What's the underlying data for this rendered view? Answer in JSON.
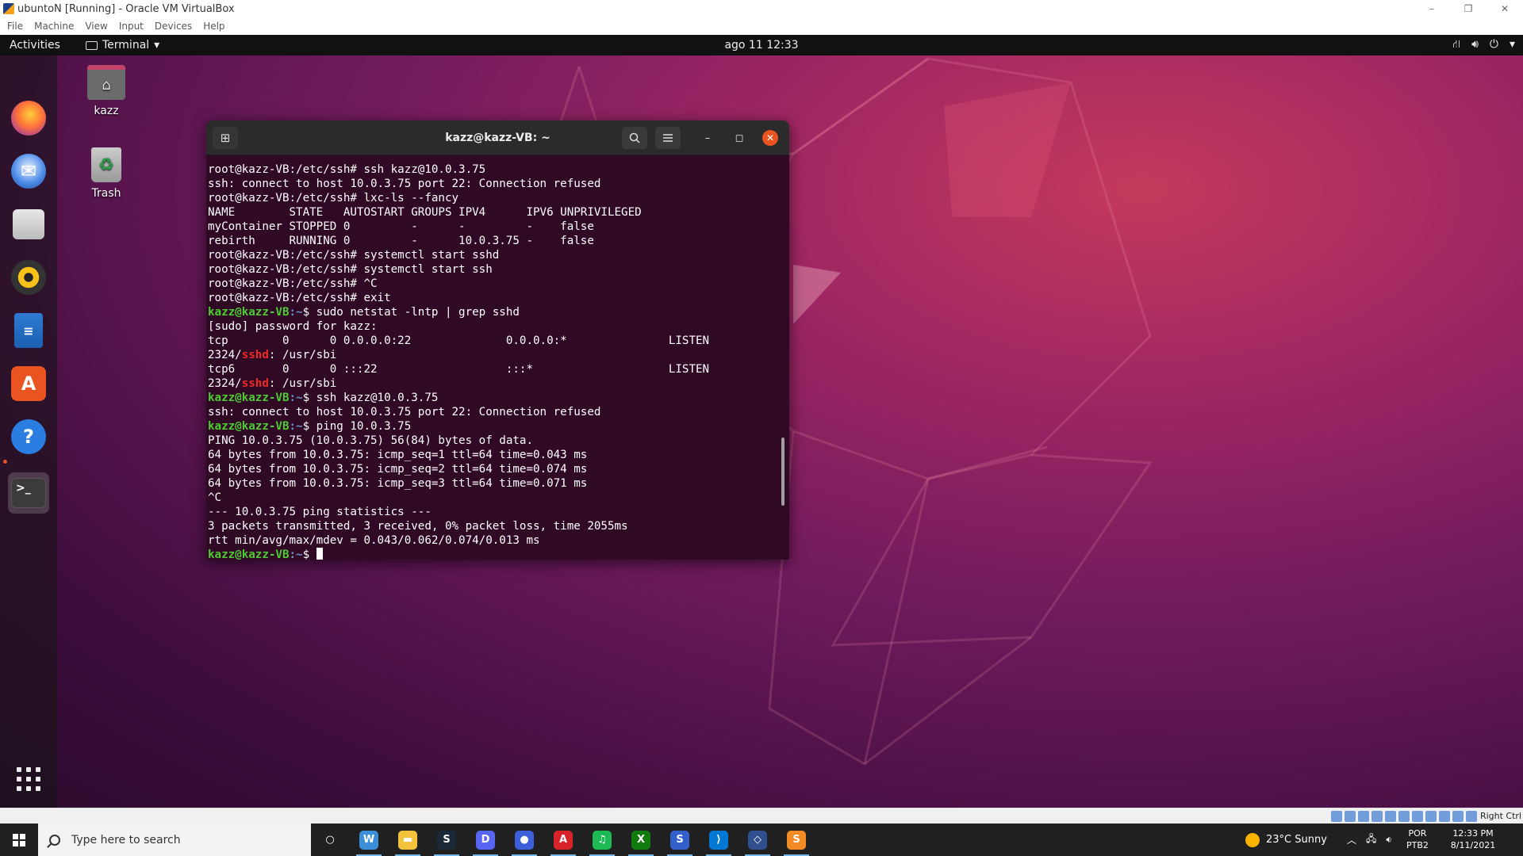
{
  "host_window": {
    "title": "ubuntoN [Running] - Oracle VM VirtualBox",
    "controls": [
      "–",
      "❐",
      "✕"
    ],
    "menu": [
      "File",
      "Machine",
      "View",
      "Input",
      "Devices",
      "Help"
    ]
  },
  "gnome": {
    "activities": "Activities",
    "app_menu": "Terminal",
    "clock": "ago 11  12:33",
    "tray_icons": [
      "network-icon",
      "volume-icon",
      "power-icon",
      "chevron-down-icon"
    ]
  },
  "dock": {
    "apps": [
      "firefox-icon",
      "thunderbird-icon",
      "files-icon",
      "rhythmbox-icon",
      "libreoffice-writer-icon",
      "software-icon",
      "help-icon",
      "terminal-icon"
    ]
  },
  "desktop": {
    "home_label": "kazz",
    "trash_label": "Trash"
  },
  "terminal": {
    "title": "kazz@kazz-VB: ~",
    "prompt_user": "kazz@kazz-VB",
    "prompt_path": ":~",
    "prompt_sym": "$ ",
    "lines": [
      {
        "t": "root@kazz-VB:/etc/ssh# ssh kazz@10.0.3.75"
      },
      {
        "t": "ssh: connect to host 10.0.3.75 port 22: Connection refused"
      },
      {
        "t": "root@kazz-VB:/etc/ssh# lxc-ls --fancy"
      },
      {
        "t": "NAME        STATE   AUTOSTART GROUPS IPV4      IPV6 UNPRIVILEGED"
      },
      {
        "t": "myContainer STOPPED 0         -      -         -    false"
      },
      {
        "t": "rebirth     RUNNING 0         -      10.0.3.75 -    false"
      },
      {
        "t": "root@kazz-VB:/etc/ssh# systemctl start sshd"
      },
      {
        "t": "root@kazz-VB:/etc/ssh# systemctl start ssh"
      },
      {
        "t": "root@kazz-VB:/etc/ssh# ^C"
      },
      {
        "t": "root@kazz-VB:/etc/ssh# exit"
      },
      {
        "p": true,
        "t": "sudo netstat -lntp | grep sshd"
      },
      {
        "t": "[sudo] password for kazz:"
      },
      {
        "t": "tcp        0      0 0.0.0.0:22              0.0.0.0:*               LISTEN"
      },
      {
        "pre": "2324/",
        "hl": "sshd",
        "post": ": /usr/sbi"
      },
      {
        "t": "tcp6       0      0 :::22                   :::*                    LISTEN"
      },
      {
        "pre": "2324/",
        "hl": "sshd",
        "post": ": /usr/sbi"
      },
      {
        "p": true,
        "t": "ssh kazz@10.0.3.75"
      },
      {
        "t": "ssh: connect to host 10.0.3.75 port 22: Connection refused"
      },
      {
        "p": true,
        "t": "ping 10.0.3.75"
      },
      {
        "t": "PING 10.0.3.75 (10.0.3.75) 56(84) bytes of data."
      },
      {
        "t": "64 bytes from 10.0.3.75: icmp_seq=1 ttl=64 time=0.043 ms"
      },
      {
        "t": "64 bytes from 10.0.3.75: icmp_seq=2 ttl=64 time=0.074 ms"
      },
      {
        "t": "64 bytes from 10.0.3.75: icmp_seq=3 ttl=64 time=0.071 ms"
      },
      {
        "t": "^C"
      },
      {
        "t": "--- 10.0.3.75 ping statistics ---"
      },
      {
        "t": "3 packets transmitted, 3 received, 0% packet loss, time 2055ms"
      },
      {
        "t": "rtt min/avg/max/mdev = 0.043/0.062/0.074/0.013 ms"
      },
      {
        "p": true,
        "t": "",
        "cursor": true
      }
    ]
  },
  "vbox_status": {
    "host_key": "Right Ctrl"
  },
  "taskbar": {
    "search_placeholder": "Type here to search",
    "apps": [
      {
        "name": "cortana-icon",
        "glyph": "○",
        "color": "transparent"
      },
      {
        "name": "winaero-icon",
        "glyph": "W",
        "color": "#3a8fd8"
      },
      {
        "name": "file-explorer-icon",
        "glyph": "▬",
        "color": "#f3c23c"
      },
      {
        "name": "steam-icon",
        "glyph": "S",
        "color": "#1b2838"
      },
      {
        "name": "discord-icon",
        "glyph": "D",
        "color": "#5865f2"
      },
      {
        "name": "orb-icon",
        "glyph": "●",
        "color": "#3d5fd9"
      },
      {
        "name": "amd-icon",
        "glyph": "A",
        "color": "#d8232a"
      },
      {
        "name": "spotify-icon",
        "glyph": "♫",
        "color": "#1db954"
      },
      {
        "name": "xbox-icon",
        "glyph": "X",
        "color": "#107c10"
      },
      {
        "name": "simplenote-icon",
        "glyph": "S",
        "color": "#3361cc"
      },
      {
        "name": "vscode-icon",
        "glyph": "⟩",
        "color": "#0078d4"
      },
      {
        "name": "virtualbox-icon",
        "glyph": "◇",
        "color": "#2f4f8f"
      },
      {
        "name": "sublime-icon",
        "glyph": "S",
        "color": "#f28b25"
      }
    ],
    "weather": "23°C  Sunny",
    "language": "POR",
    "layout": "PTB2",
    "time": "12:33 PM",
    "date": "8/11/2021"
  }
}
